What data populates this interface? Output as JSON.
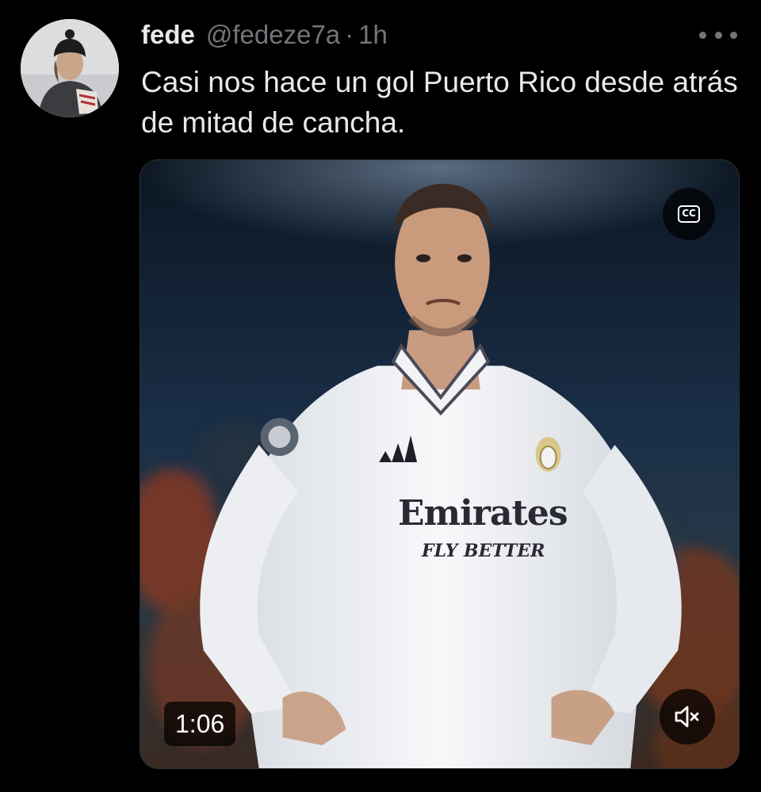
{
  "tweet": {
    "author_name": "fede",
    "handle": "@fedeze7a",
    "separator": "·",
    "time": "1h",
    "text": "Casi nos hace un gol Puerto Rico desde atrás de mitad de cancha."
  },
  "media": {
    "type": "video",
    "duration": "1:06",
    "captions_label": "CC",
    "muted": true,
    "jersey_sponsor": "Emirates",
    "jersey_slogan": "FLY BETTER"
  },
  "icons": {
    "more": "more-dots-icon",
    "captions": "captions-icon",
    "mute": "speaker-muted-icon"
  },
  "colors": {
    "background": "#000000",
    "text_primary": "#e7e9ea",
    "text_secondary": "#71767b"
  }
}
